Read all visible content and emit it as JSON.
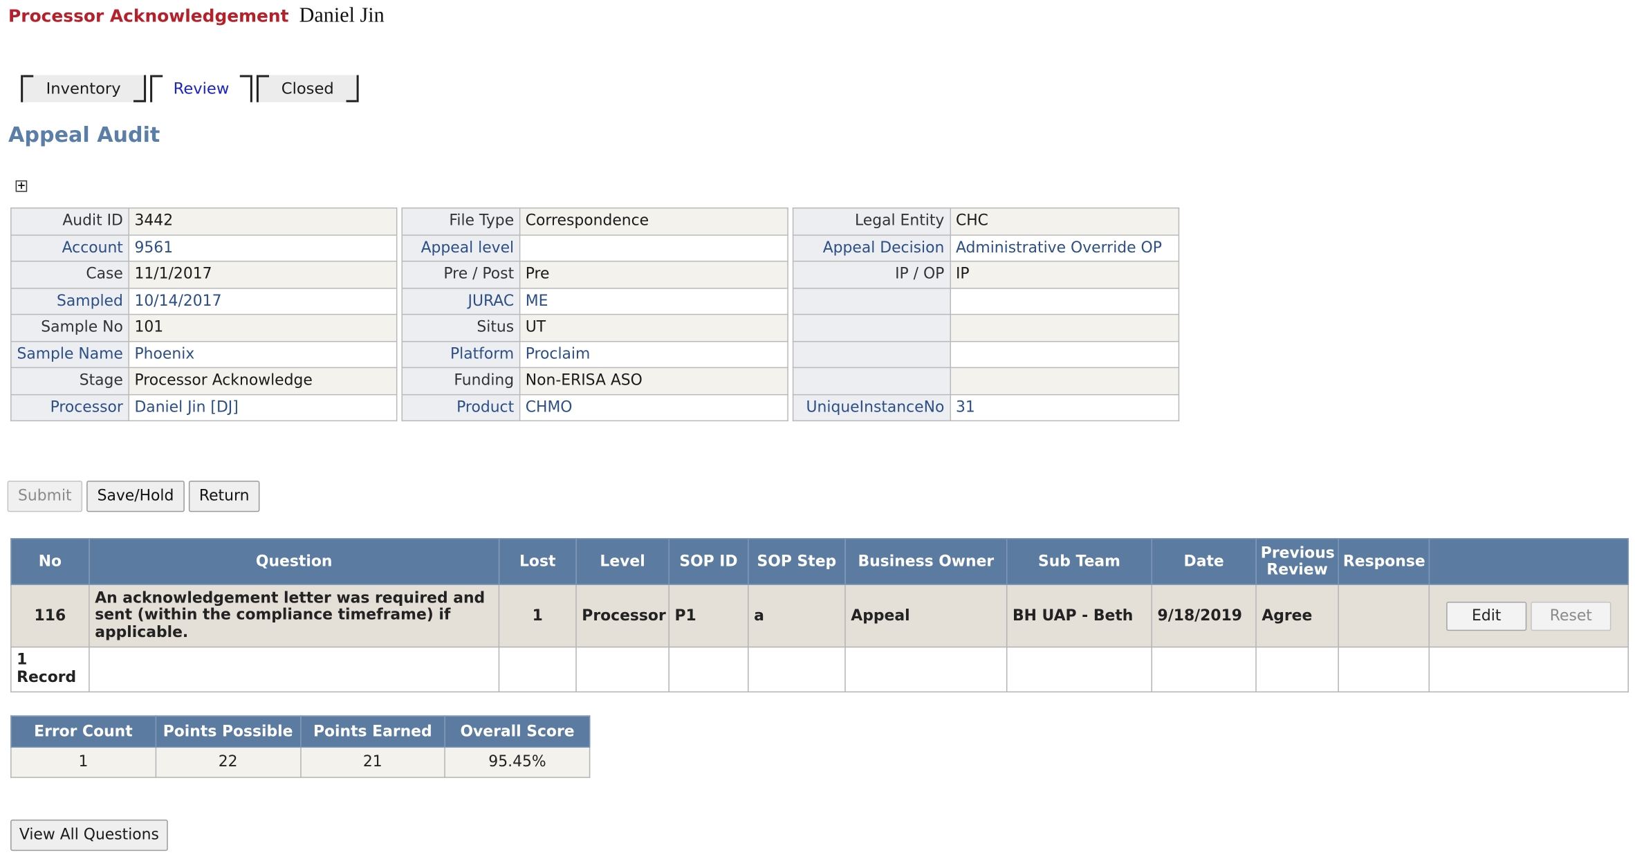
{
  "header": {
    "title": "Processor Acknowledgement",
    "user": "Daniel Jin"
  },
  "tabs": [
    {
      "label": "Inventory",
      "active": false
    },
    {
      "label": "Review",
      "active": true
    },
    {
      "label": "Closed",
      "active": false
    }
  ],
  "page_title": "Appeal Audit",
  "expander": "+",
  "info_col1": [
    {
      "label": "Audit ID",
      "value": "3442"
    },
    {
      "label": "Account",
      "value": "9561"
    },
    {
      "label": "Case",
      "value": "11/1/2017"
    },
    {
      "label": "Sampled",
      "value": "10/14/2017"
    },
    {
      "label": "Sample No",
      "value": "101"
    },
    {
      "label": "Sample Name",
      "value": "Phoenix"
    },
    {
      "label": "Stage",
      "value": "Processor Acknowledge"
    },
    {
      "label": "Processor",
      "value": "Daniel Jin [DJ]"
    }
  ],
  "info_col2": [
    {
      "label": "File Type",
      "value": "Correspondence"
    },
    {
      "label": "Appeal level",
      "value": ""
    },
    {
      "label": "Pre / Post",
      "value": "Pre"
    },
    {
      "label": "JURAC",
      "value": "ME"
    },
    {
      "label": "Situs",
      "value": "UT"
    },
    {
      "label": "Platform",
      "value": "Proclaim"
    },
    {
      "label": "Funding",
      "value": "Non-ERISA ASO"
    },
    {
      "label": "Product",
      "value": "CHMO"
    }
  ],
  "info_col3": [
    {
      "label": "Legal Entity",
      "value": "CHC"
    },
    {
      "label": "Appeal Decision",
      "value": "Administrative Override OP"
    },
    {
      "label": "IP / OP",
      "value": "IP"
    },
    {
      "label": "",
      "value": ""
    },
    {
      "label": "",
      "value": ""
    },
    {
      "label": "",
      "value": ""
    },
    {
      "label": "",
      "value": ""
    },
    {
      "label": "UniqueInstanceNo",
      "value": "31"
    }
  ],
  "actions": {
    "submit": "Submit",
    "save_hold": "Save/Hold",
    "return": "Return"
  },
  "questions": {
    "headers": [
      "No",
      "Question",
      "Lost",
      "Level",
      "SOP ID",
      "SOP Step",
      "Business Owner",
      "Sub Team",
      "Date",
      "Previous Review",
      "Response",
      ""
    ],
    "rows": [
      {
        "no": "116",
        "question": "An acknowledgement letter was required and sent (within the compliance timeframe) if applicable.",
        "lost": "1",
        "level": "Processor",
        "sop_id": "P1",
        "sop_step": "a",
        "business_owner": "Appeal",
        "sub_team": "BH UAP - Beth",
        "date": "9/18/2019",
        "previous_review": "Agree",
        "response": "",
        "edit_label": "Edit",
        "reset_label": "Reset"
      }
    ],
    "footer": "1 Record"
  },
  "score": {
    "headers": [
      "Error Count",
      "Points Possible",
      "Points Earned",
      "Overall Score"
    ],
    "values": [
      "1",
      "22",
      "21",
      "95.45%"
    ]
  },
  "view_all_label": "View All Questions"
}
